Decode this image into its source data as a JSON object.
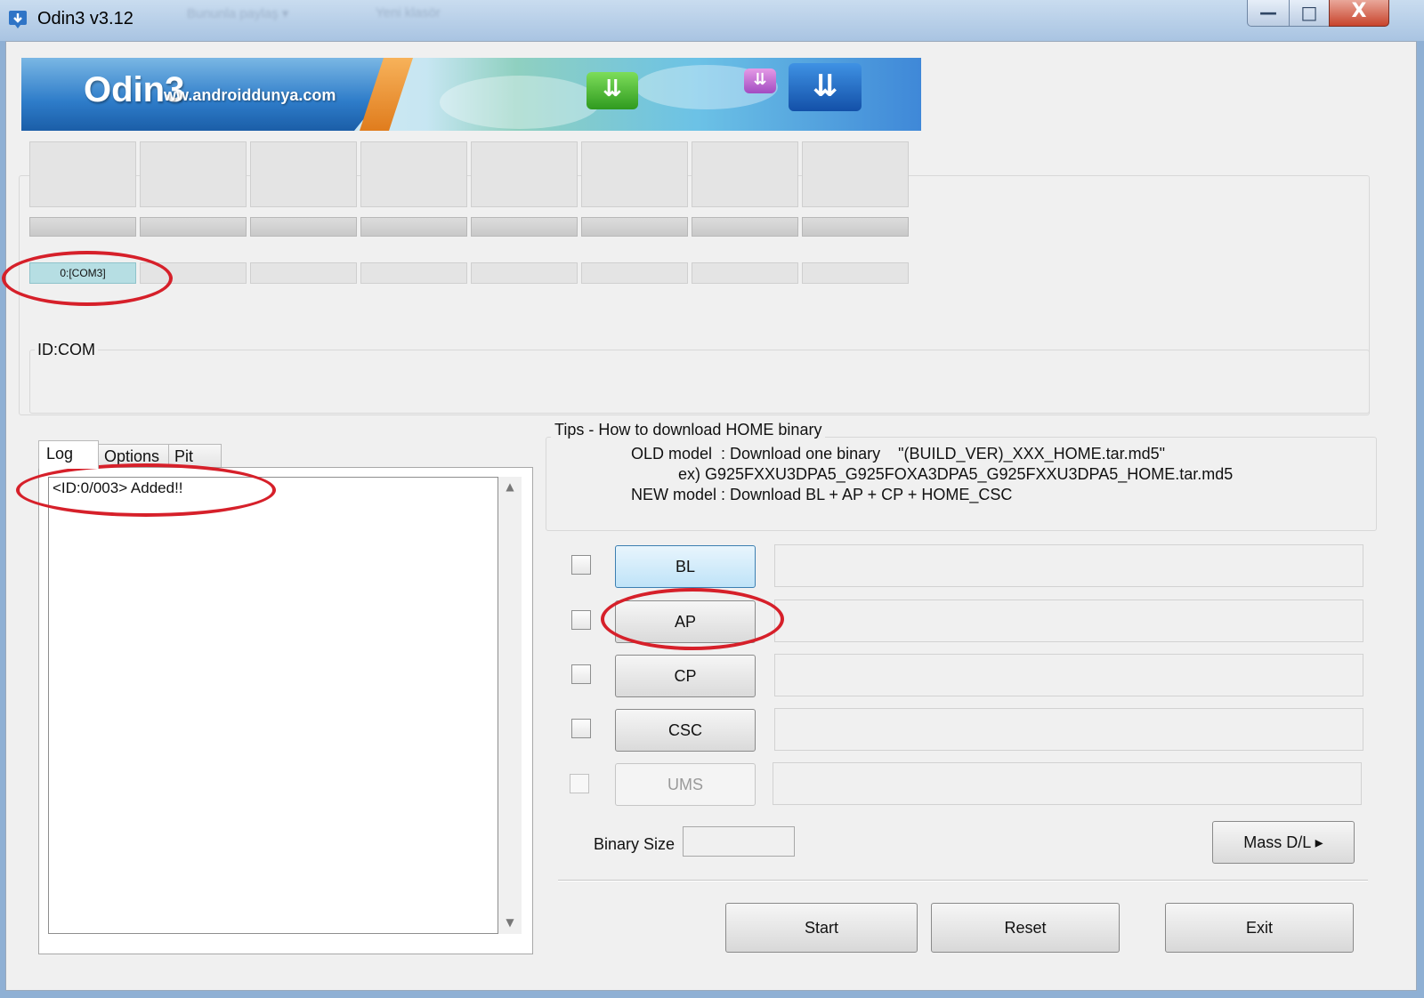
{
  "window": {
    "title": "Odin3 v3.12",
    "ghost_menu": [
      "Bununla paylaş ▾",
      "Yeni klasör"
    ],
    "controls": {
      "minimize": "—",
      "maximize": "□",
      "close": "X"
    }
  },
  "banner": {
    "logo": "Odin3",
    "url": "ww.androiddunya.com"
  },
  "ports": {
    "labels": [
      "0:[COM3]",
      "",
      "",
      "",
      "",
      "",
      "",
      ""
    ],
    "active_index": 0
  },
  "id_com": {
    "label": "ID:COM"
  },
  "tabs": {
    "log": "Log",
    "options": "Options",
    "pit": "Pit"
  },
  "log": {
    "lines": [
      "<ID:0/003> Added!!"
    ]
  },
  "tips": {
    "title": "Tips - How to download HOME binary",
    "line1": "OLD model  : Download one binary    \"(BUILD_VER)_XXX_HOME.tar.md5\"",
    "line2": "ex) G925FXXU3DPA5_G925FOXA3DPA5_G925FXXU3DPA5_HOME.tar.md5",
    "line3": "NEW model : Download BL + AP + CP + HOME_CSC"
  },
  "files": [
    {
      "label": "BL",
      "path": "",
      "checked": false,
      "enabled": true,
      "focused": true
    },
    {
      "label": "AP",
      "path": "",
      "checked": false,
      "enabled": true
    },
    {
      "label": "CP",
      "path": "",
      "checked": false,
      "enabled": true
    },
    {
      "label": "CSC",
      "path": "",
      "checked": false,
      "enabled": true
    },
    {
      "label": "UMS",
      "path": "",
      "checked": false,
      "enabled": false
    }
  ],
  "binary_size": {
    "label": "Binary Size",
    "value": ""
  },
  "buttons": {
    "mass_dl": "Mass D/L ▸",
    "start": "Start",
    "reset": "Reset",
    "exit": "Exit"
  },
  "colors": {
    "annotation": "#d6202a",
    "active_port": "#b6dee3"
  }
}
